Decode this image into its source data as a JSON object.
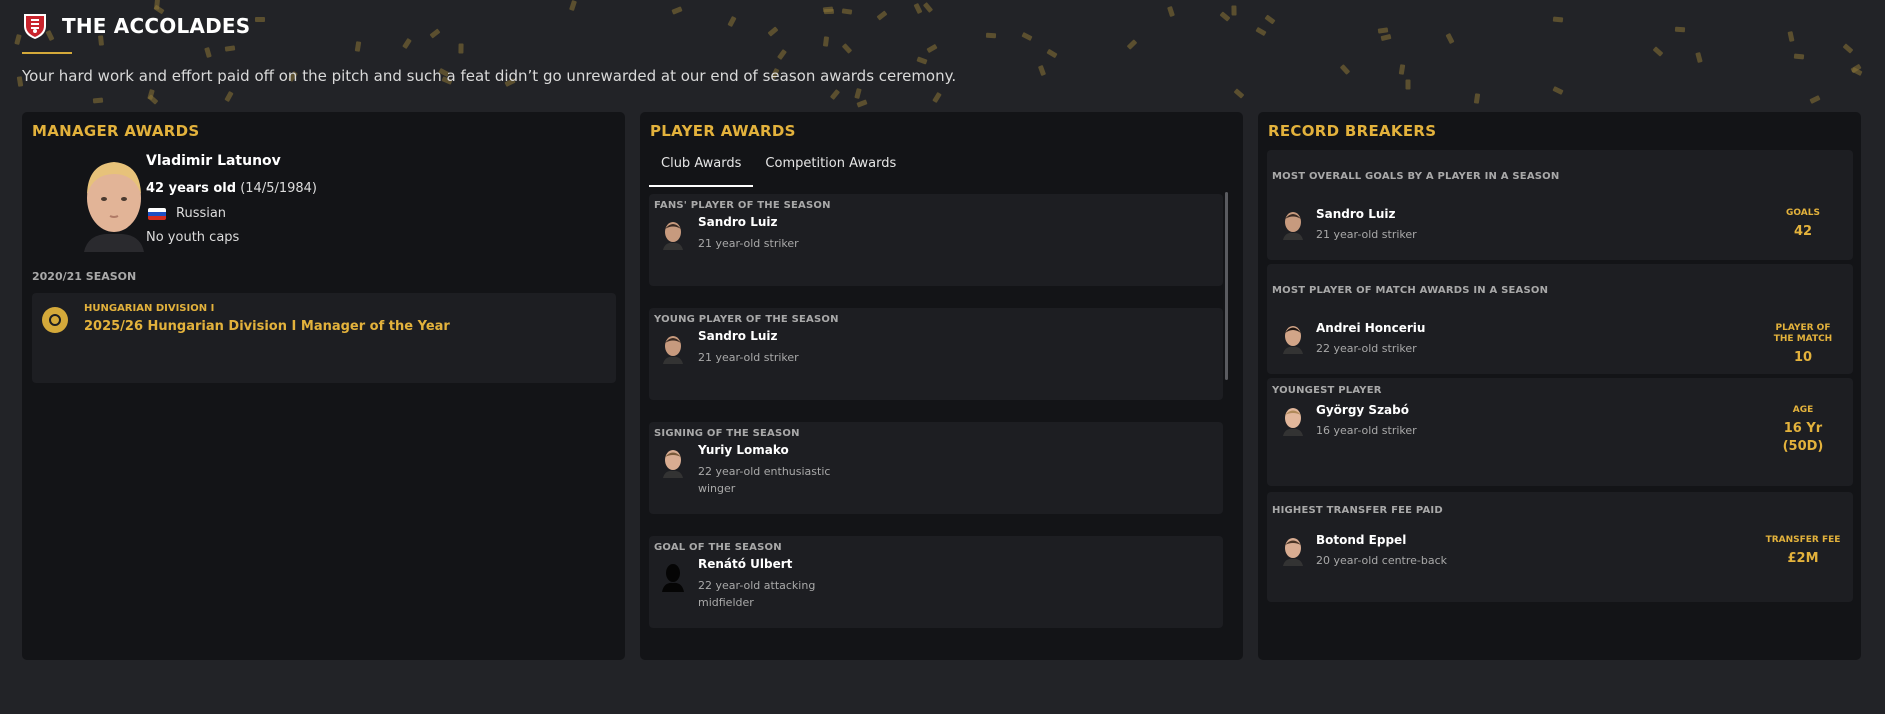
{
  "header": {
    "title": "THE ACCOLADES",
    "intro": "Your hard work and effort paid off on the pitch and such a feat didn’t go unrewarded at our end of season awards ceremony."
  },
  "colors": {
    "accent": "#e3b23c",
    "background": "#222327",
    "panel": "#131417",
    "card": "#1d1e22"
  },
  "manager_awards": {
    "title": "MANAGER AWARDS",
    "name": "Vladimir Latunov",
    "age": "42 years old",
    "dob": "(14/5/1984)",
    "nationality": "Russian",
    "youth_caps": "No youth caps",
    "season": "2020/21 SEASON",
    "award": {
      "icon": "medal-icon",
      "competition": "HUNGARIAN DIVISION I",
      "name": "2025/26 Hungarian Division I Manager of the Year"
    }
  },
  "player_awards": {
    "title": "PLAYER AWARDS",
    "tabs": [
      "Club Awards",
      "Competition Awards"
    ],
    "active_tab": "Club Awards",
    "cards": [
      {
        "title": "FANS' PLAYER OF THE SEASON",
        "name": "Sandro Luiz",
        "desc": "21 year-old striker"
      },
      {
        "title": "YOUNG PLAYER OF THE SEASON",
        "name": "Sandro Luiz",
        "desc": "21 year-old striker"
      },
      {
        "title": "SIGNING OF THE SEASON",
        "name": "Yuriy Lomako",
        "desc": "22 year-old enthusiastic winger"
      },
      {
        "title": "GOAL OF THE SEASON",
        "name": "Renátó Ulbert",
        "desc": "22 year-old attacking midfielder"
      }
    ]
  },
  "record_breakers": {
    "title": "RECORD BREAKERS",
    "cards": [
      {
        "title": "MOST OVERALL GOALS BY A PLAYER IN A SEASON",
        "name": "Sandro Luiz",
        "desc": "21 year-old striker",
        "stat_label": "GOALS",
        "stat_value": "42"
      },
      {
        "title": "MOST PLAYER OF MATCH AWARDS IN A SEASON",
        "name": "Andrei Honceriu",
        "desc": "22 year-old striker",
        "stat_label": "PLAYER OF THE MATCH",
        "stat_value": "10"
      },
      {
        "title": "YOUNGEST PLAYER",
        "name": "György Szabó",
        "desc": "16 year-old striker",
        "stat_label": "AGE",
        "stat_value": "16 Yr (50D)"
      },
      {
        "title": "HIGHEST TRANSFER FEE PAID",
        "name": "Botond Eppel",
        "desc": "20 year-old centre-back",
        "stat_label": "TRANSFER FEE",
        "stat_value": "£2M"
      }
    ]
  }
}
